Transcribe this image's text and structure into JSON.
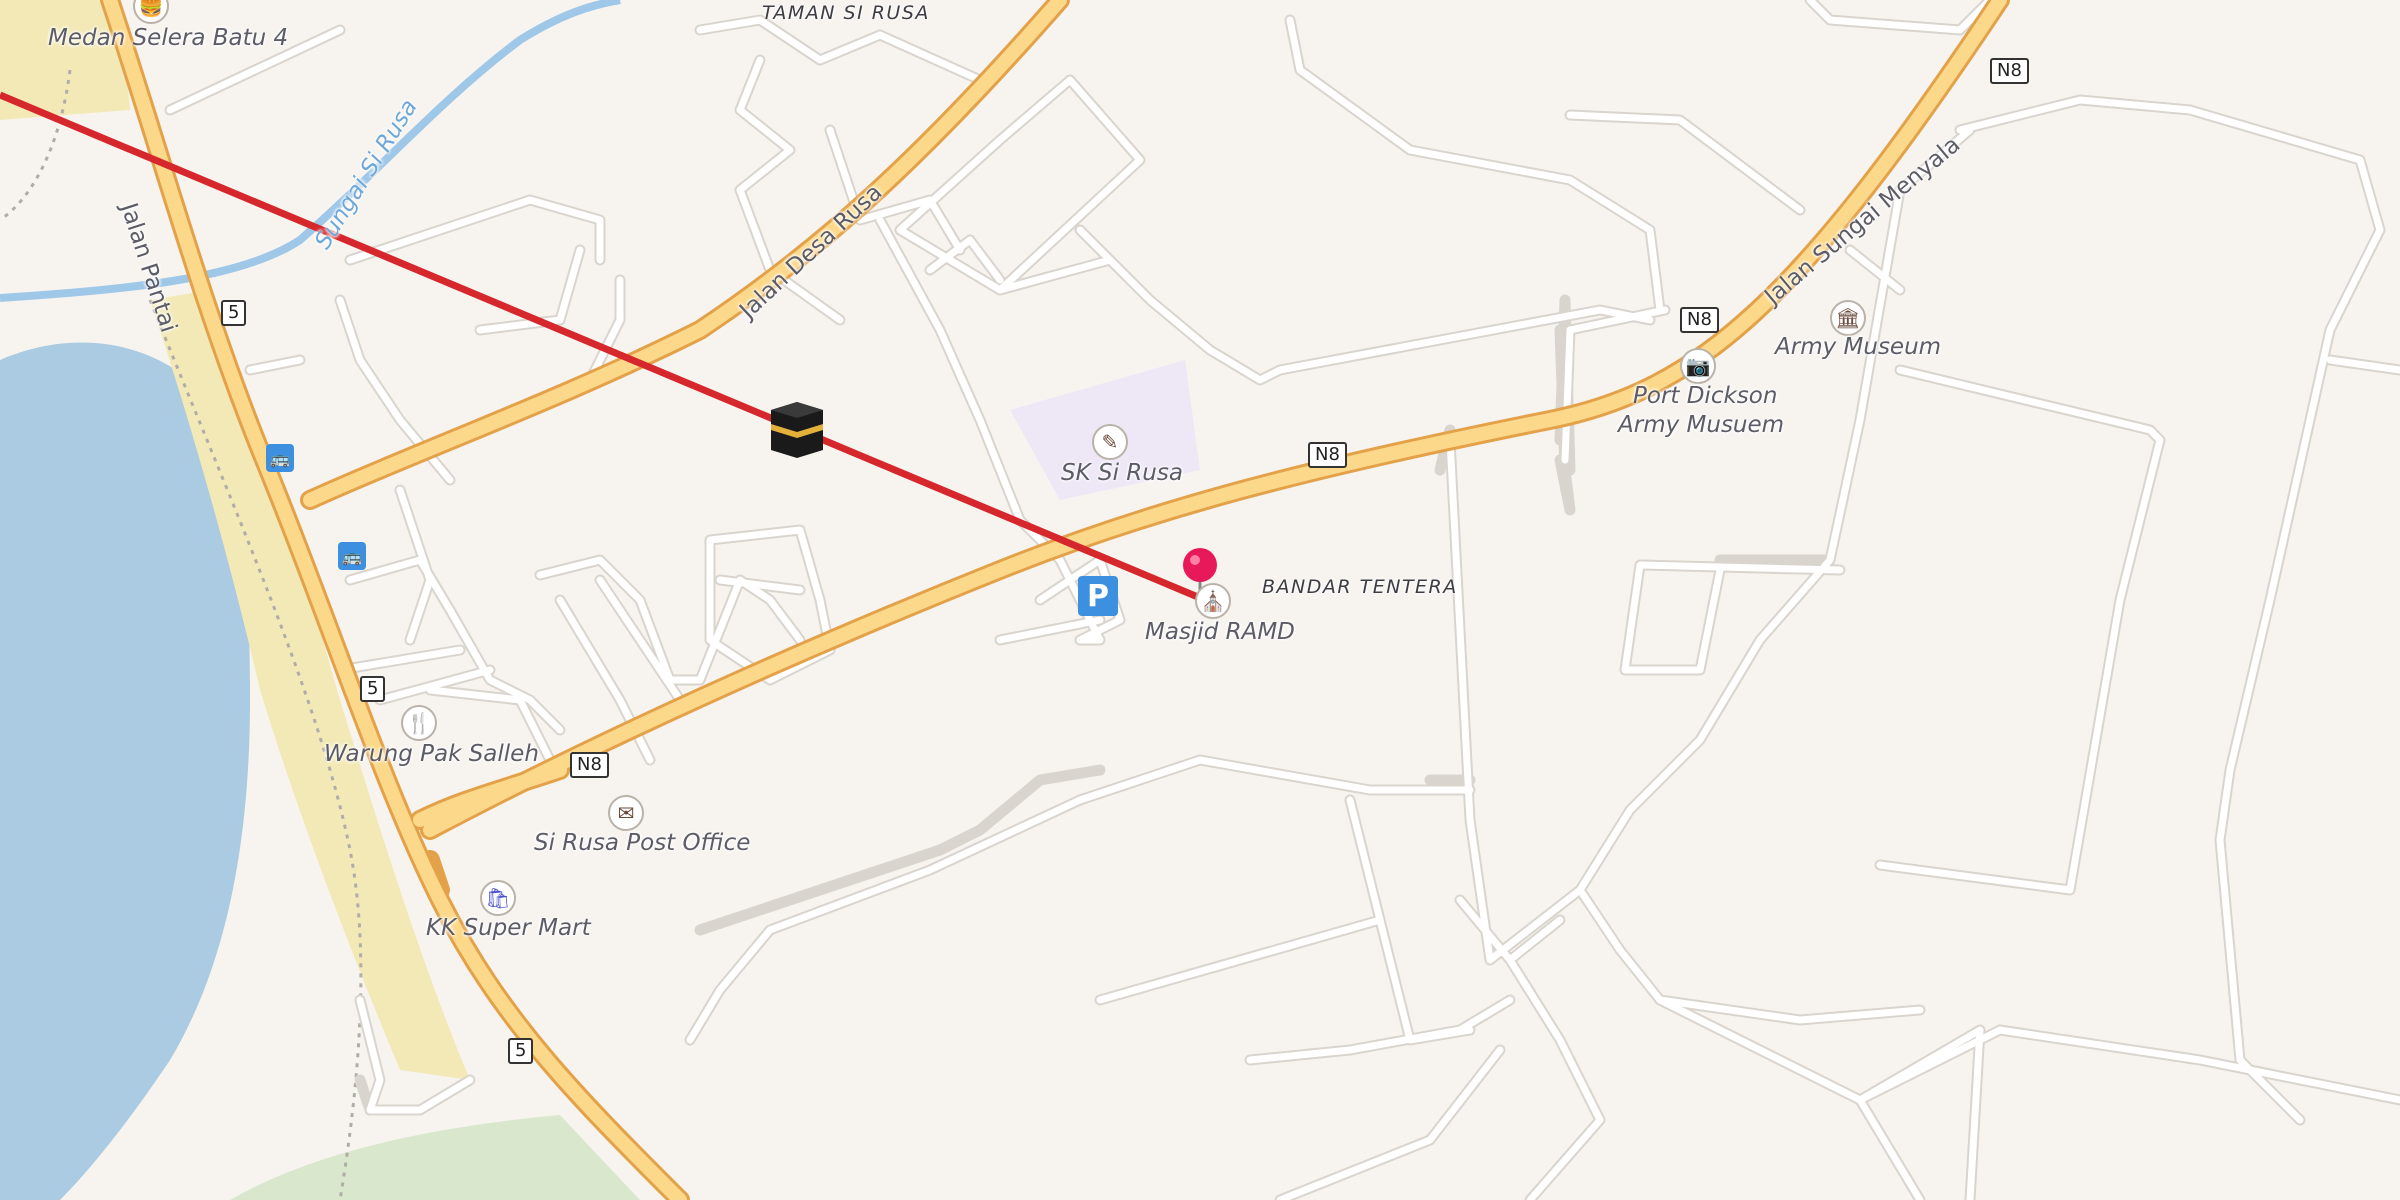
{
  "map": {
    "area_labels": {
      "taman": "TAMAN SI RUSA",
      "bandar": "BANDAR TENTERA"
    },
    "road_labels": {
      "jalan_pantai": "Jalan Pantai",
      "jalan_desa_rusa": "Jalan Desa Rusa",
      "jalan_sungai_menyala": "Jalan Sungai Menyala",
      "sungai": "Sungai Si Rusa"
    },
    "shields": {
      "route5": "5",
      "n8": "N8"
    },
    "pois": {
      "medan": "Medan Selera Batu 4",
      "sk": "SK Si Rusa",
      "masjid": "Masjid RAMD",
      "warung": "Warung Pak Salleh",
      "post": "Si Rusa Post Office",
      "kk": "KK Super Mart",
      "army_museum": "Army Museum",
      "pd_line1": "Port Dickson",
      "pd_line2": "Army  Musuem"
    },
    "icons": {
      "medan": "burger-icon",
      "sk": "school-icon",
      "masjid": "mosque-icon",
      "warung": "restaurant-icon",
      "post": "mail-icon",
      "kk": "shopping-bag-icon",
      "army_museum": "museum-icon",
      "pd": "camera-icon",
      "kaaba": "kaaba-icon",
      "pin": "location-pin-icon",
      "bus": "bus-stop-icon",
      "parking": "parking-icon"
    },
    "parking_label": "P",
    "colors": {
      "background": "#f7f4f0",
      "water": "#aacbe1",
      "main_road": "#fcd98a",
      "road_casing": "#e3a24a",
      "qibla_line": "#d6272c",
      "pin": "#e8195a"
    }
  }
}
